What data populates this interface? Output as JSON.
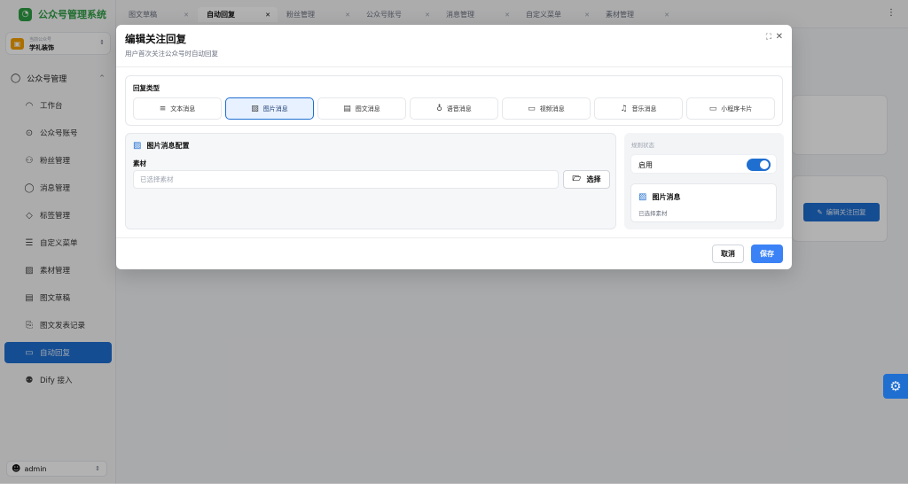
{
  "brand": {
    "name": "公众号管理系统",
    "logo_icon": "wechat-logo"
  },
  "account": {
    "caption": "当前公众号",
    "name": "学礼装饰"
  },
  "nav": {
    "group_label": "公众号管理",
    "items": [
      {
        "label": "工作台",
        "icon": "dashboard-icon"
      },
      {
        "label": "公众号账号",
        "icon": "account-check-icon"
      },
      {
        "label": "粉丝管理",
        "icon": "users-icon"
      },
      {
        "label": "消息管理",
        "icon": "message-icon"
      },
      {
        "label": "标签管理",
        "icon": "tag-icon"
      },
      {
        "label": "自定义菜单",
        "icon": "menu-icon"
      },
      {
        "label": "素材管理",
        "icon": "image-icon"
      },
      {
        "label": "图文草稿",
        "icon": "newspaper-icon"
      },
      {
        "label": "图文发表记录",
        "icon": "history-icon"
      },
      {
        "label": "自动回复",
        "icon": "auto-reply-icon"
      },
      {
        "label": "Dify 接入",
        "icon": "bot-icon"
      }
    ],
    "active_index": 9
  },
  "user": {
    "name": "admin"
  },
  "tabs": [
    {
      "label": "图文草稿"
    },
    {
      "label": "自动回复"
    },
    {
      "label": "粉丝管理"
    },
    {
      "label": "公众号账号"
    },
    {
      "label": "消息管理"
    },
    {
      "label": "自定义菜单"
    },
    {
      "label": "素材管理"
    }
  ],
  "background": {
    "edit_button": "编辑关注回复"
  },
  "modal": {
    "title": "编辑关注回复",
    "subtitle": "用户首次关注公众号时自动回复",
    "reply_type_label": "回复类型",
    "reply_types": [
      {
        "label": "文本消息",
        "icon": "text-icon"
      },
      {
        "label": "图片消息",
        "icon": "image-icon"
      },
      {
        "label": "图文消息",
        "icon": "news-icon"
      },
      {
        "label": "语音消息",
        "icon": "mic-icon"
      },
      {
        "label": "视频消息",
        "icon": "video-icon"
      },
      {
        "label": "音乐消息",
        "icon": "music-icon"
      },
      {
        "label": "小程序卡片",
        "icon": "card-icon"
      }
    ],
    "selected_type": "图片消息",
    "config": {
      "title": "图片消息配置",
      "material_label": "素材",
      "material_placeholder": "已选择素材",
      "select_button": "选择"
    },
    "side": {
      "heading": "规则状态",
      "enabled_label": "启用",
      "enabled": true,
      "card_title": "图片消息",
      "card_sub": "已选择素材"
    },
    "cancel": "取消",
    "save": "保存"
  },
  "colors": {
    "primary": "#1f6fd1",
    "brand_green": "#2f9e44",
    "save_blue": "#3b82f6"
  }
}
